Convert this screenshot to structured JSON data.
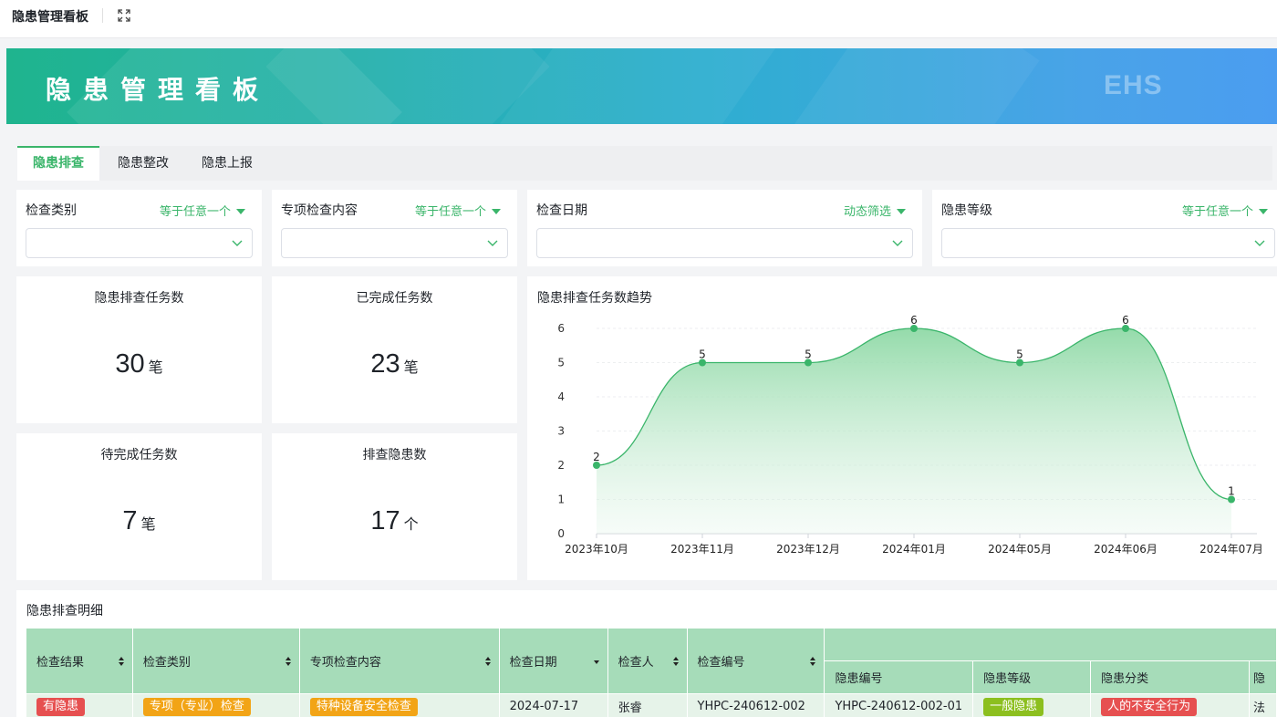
{
  "header": {
    "title": "隐患管理看板",
    "expand_icon": "expand-icon"
  },
  "banner": {
    "title": "隐患管理看板",
    "badge": "EHS"
  },
  "tabs": [
    {
      "label": "隐患排查",
      "active": true
    },
    {
      "label": "隐患整改",
      "active": false
    },
    {
      "label": "隐患上报",
      "active": false
    }
  ],
  "filters": [
    {
      "label": "检查类别",
      "operator": "等于任意一个",
      "value": ""
    },
    {
      "label": "专项检查内容",
      "operator": "等于任意一个",
      "value": ""
    },
    {
      "label": "检查日期",
      "operator": "动态筛选",
      "value": ""
    },
    {
      "label": "隐患等级",
      "operator": "等于任意一个",
      "value": ""
    }
  ],
  "kpis": [
    {
      "label": "隐患排查任务数",
      "value": "30",
      "unit": "笔"
    },
    {
      "label": "已完成任务数",
      "value": "23",
      "unit": "笔"
    },
    {
      "label": "待完成任务数",
      "value": "7",
      "unit": "笔"
    },
    {
      "label": "排查隐患数",
      "value": "17",
      "unit": "个"
    }
  ],
  "trend": {
    "title": "隐患排查任务数趋势"
  },
  "chart_data": {
    "type": "area",
    "title": "隐患排查任务数趋势",
    "categories": [
      "2023年10月",
      "2023年11月",
      "2023年12月",
      "2024年01月",
      "2024年05月",
      "2024年06月",
      "2024年07月"
    ],
    "values": [
      2,
      5,
      5,
      6,
      5,
      6,
      1
    ],
    "ylim": [
      0,
      6
    ],
    "yticks": [
      0,
      1,
      2,
      3,
      4,
      5,
      6
    ],
    "grid": true,
    "smooth": true,
    "color": "#3ab56a"
  },
  "detail": {
    "title": "隐患排查明细",
    "columns": [
      "检查结果",
      "检查类别",
      "专项检查内容",
      "检查日期",
      "检查人",
      "检查编号"
    ],
    "sub_columns": [
      "隐患编号",
      "隐患等级",
      "隐患分类",
      "隐"
    ],
    "rows": [
      {
        "result": "有隐患",
        "category": "专项（专业）检查",
        "content": "特种设备安全检查",
        "date": "2024-07-17",
        "inspector": "张睿",
        "check_no": "YHPC-240612-002",
        "hazard_no": "YHPC-240612-002-01",
        "level": "一般隐患",
        "class": "人的不安全行为",
        "extra": "法"
      }
    ]
  },
  "colors": {
    "accent": "#3ab56a",
    "header_row": "#a6dcb9",
    "body_row": "#e6f3e9",
    "tag_red": "#e65050",
    "tag_orange": "#f2a416",
    "tag_olive": "#8cbf1f"
  }
}
